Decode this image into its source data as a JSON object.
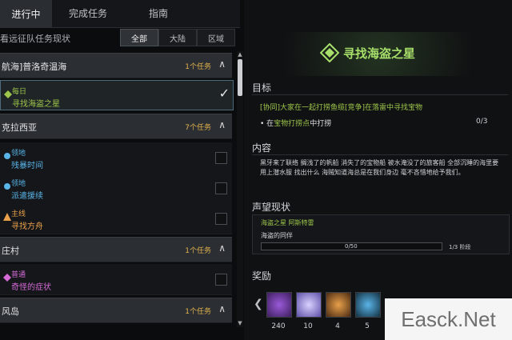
{
  "tabs": [
    {
      "label": "进行中"
    },
    {
      "label": "完成任务"
    },
    {
      "label": "指南"
    }
  ],
  "subheader": {
    "label": "看远征队任务现状",
    "filters": [
      "全部",
      "大陆",
      "区域"
    ]
  },
  "categories": [
    {
      "name": "航海]普洛奇温海",
      "count": "1个任务",
      "items": [
        {
          "type": "每日",
          "title": "寻找海盗之星",
          "color": "#9ec64a",
          "selected": true
        }
      ]
    },
    {
      "name": "克拉西亚",
      "count": "7个任务",
      "items": [
        {
          "type": "领地",
          "title": "残暴时间",
          "color": "#59b4e8"
        },
        {
          "type": "领地",
          "title": "派遣援续",
          "color": "#59b4e8"
        },
        {
          "type": "主线",
          "title": "寻找方舟",
          "color": "#e8a04a"
        }
      ]
    },
    {
      "name": "庄村",
      "count": "1个任务",
      "items": [
        {
          "type": "普通",
          "title": "奇怪的症状",
          "color": "#d66ad8"
        }
      ]
    },
    {
      "name": "风岛",
      "count": "1个任务",
      "items": []
    }
  ],
  "detail": {
    "title": "寻找海盗之星",
    "goal_header": "目标",
    "goal_line1": "[协同]大家在一起打捞鱼缆[竞争]在落雷中寻找宝物",
    "goal_line2_prefix": "• 在",
    "goal_line2_highlight": "宝物打捞点",
    "goal_line2_suffix": "中打捞",
    "goal_progress": "0/3",
    "content_header": "内容",
    "content_text": "黑牙来了联络 搁浅了的帆船 消失了的宝物船 被水淹没了的旅客船 全部沉睡的海里要用上潜水服 找出什么 海贼知道海总是在我们身边 毫不吝惜地给予我们。",
    "reputation_header": "声望现状",
    "rep_name": "海盗之星 阿斯特雷",
    "rep_rank_name": "海盗的同伴",
    "rep_progress_text": "0/50",
    "rep_progress_fraction": 0.0,
    "rep_rank": "1/3 阶段",
    "reward_header": "奖励",
    "rewards": [
      {
        "icon": "purple-crystal-icon",
        "count": "240"
      },
      {
        "icon": "diamond-icon",
        "count": "10"
      },
      {
        "icon": "flame-item-icon",
        "count": "4"
      },
      {
        "icon": "potion-icon",
        "count": "5"
      }
    ]
  },
  "watermark": "Easck.Net",
  "colors": {
    "accent_green": "#9ec64a",
    "accent_gold": "#e0b24c",
    "bg": "#0b0c0e"
  }
}
